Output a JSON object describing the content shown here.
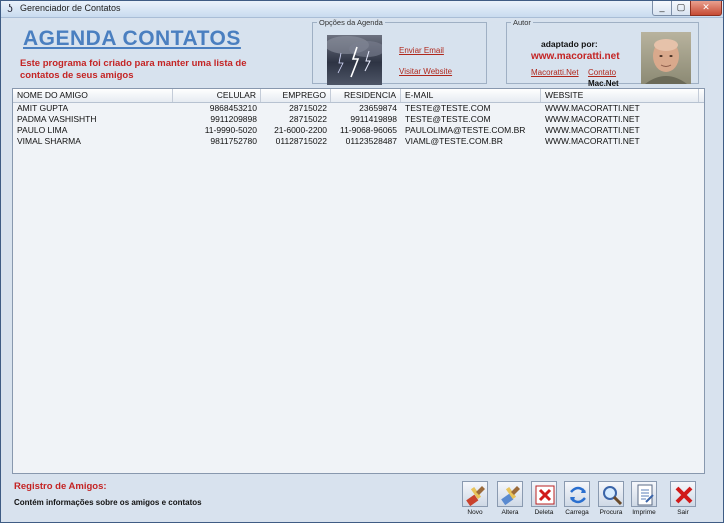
{
  "window": {
    "title": "Gerenciador de Contatos",
    "controls": {
      "minimize": "_",
      "maximize": "▢",
      "close": "✕"
    }
  },
  "header": {
    "title": "AGENDA CONTATOS",
    "subtitle": "Este programa foi criado para manter uma lista de contatos de seus amigos"
  },
  "options_group": {
    "legend": "Opções da Agenda",
    "email_link": "Enviar Email",
    "website_link": "Visitar Website"
  },
  "author_group": {
    "legend": "Autor",
    "adapted_by": "adaptado por:",
    "site": "www.macoratti.net",
    "link_site": "Macoratti.Net",
    "link_contact": "Contato",
    "brand": "Mac.Net"
  },
  "contacts": {
    "columns": [
      "NOME DO AMIGO",
      "CELULAR",
      "EMPREGO",
      "RESIDENCIA",
      "E-MAIL",
      "WEBSITE"
    ],
    "rows": [
      [
        "AMIT GUPTA",
        "9868453210",
        "28715022",
        "23659874",
        "TESTE@TESTE.COM",
        "WWW.MACORATTI.NET"
      ],
      [
        "PADMA VASHISHTH",
        "9911209898",
        "28715022",
        "9911419898",
        "TESTE@TESTE.COM",
        "WWW.MACORATTI.NET"
      ],
      [
        "PAULO LIMA",
        "11-9990-5020",
        "21-6000-2200",
        "11-9068-96065",
        "PAULOLIMA@TESTE.COM.BR",
        "WWW.MACORATTI.NET"
      ],
      [
        "VIMAL SHARMA",
        "9811752780",
        "01128715022",
        "01123528487",
        "VIAML@TESTE.COM.BR",
        "WWW.MACORATTI.NET"
      ]
    ]
  },
  "footer": {
    "title": "Registro de Amigos:",
    "description": "Contém informações sobre os amigos e contatos"
  },
  "toolbar": {
    "buttons": [
      {
        "label": "Novo",
        "icon": "brush-new-icon"
      },
      {
        "label": "Altera",
        "icon": "brush-edit-icon"
      },
      {
        "label": "Deleta",
        "icon": "delete-x-icon"
      },
      {
        "label": "Carrega",
        "icon": "reload-arrows-icon"
      },
      {
        "label": "Procura",
        "icon": "magnifier-icon"
      },
      {
        "label": "Imprime",
        "icon": "print-document-icon"
      },
      {
        "label": "Sair",
        "icon": "exit-x-icon"
      }
    ]
  },
  "colors": {
    "accent_red": "#c42424",
    "title_blue": "#4a7fc0",
    "background": "#d8e2ee"
  }
}
